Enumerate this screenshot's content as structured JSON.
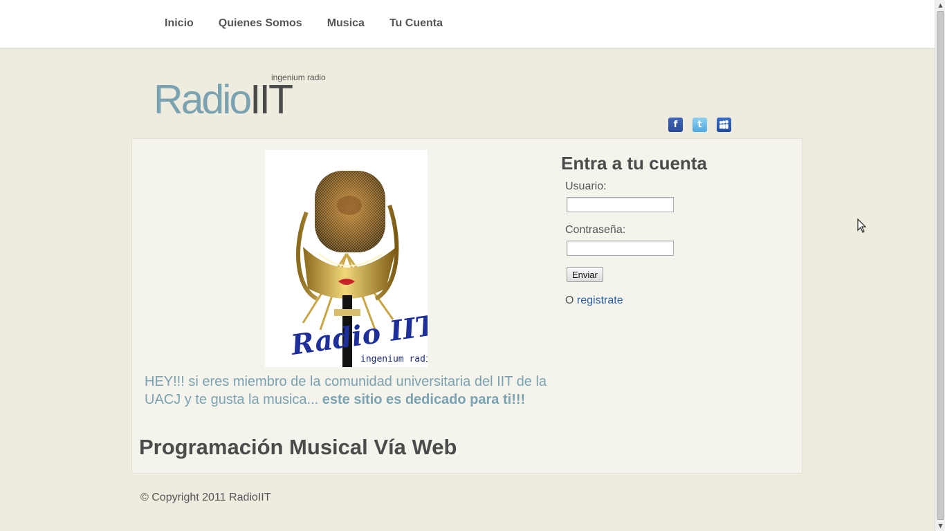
{
  "nav": {
    "items": [
      "Inicio",
      "Quienes Somos",
      "Musica",
      "Tu Cuenta"
    ]
  },
  "header": {
    "tagline": "ingenium radio",
    "logo_part1": "Radio",
    "logo_part2": "IIT"
  },
  "social": [
    "facebook-icon",
    "twitter-icon",
    "myspace-icon"
  ],
  "colors": {
    "background": "#edecdf",
    "panel": "#f4f3ec",
    "accent_blue": "#7aa2b0",
    "dark_text": "#4b4b4b",
    "link": "#2a5fa8"
  },
  "main": {
    "poster": {
      "brand": "Radio IIT...",
      "subtitle": "ingenium radio"
    },
    "intro_text": "HEY!!! si eres miembro de la comunidad universitaria del IIT de la UACJ y te gusta la musica... ",
    "intro_bold": "este sitio es dedicado para ti!!!",
    "program_title": "Programación Musical Vía Web"
  },
  "login": {
    "title": "Entra a tu cuenta",
    "username_label": "Usuario:",
    "username_value": "",
    "password_label": "Contraseña:",
    "password_value": "",
    "submit_label": "Enviar",
    "register_prefix": "O ",
    "register_link": "registrate"
  },
  "footer": {
    "copyright": "© Copyright 2011 RadioIIT"
  }
}
